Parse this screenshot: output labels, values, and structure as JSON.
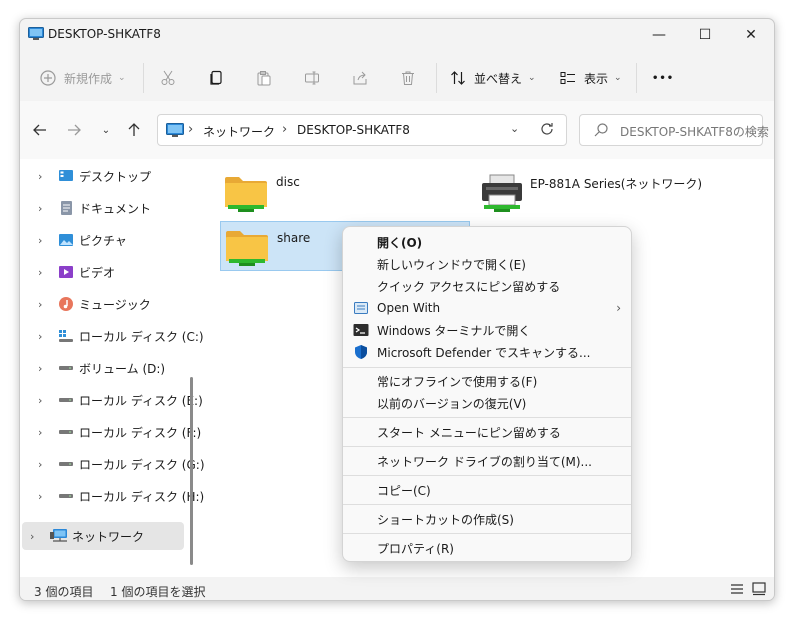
{
  "window": {
    "title": "DESKTOP-SHKATF8",
    "minimize_glyph": "—",
    "maximize_glyph": "☐",
    "close_glyph": "✕"
  },
  "toolbar": {
    "new_label": "新規作成",
    "sort_label": "並べ替え",
    "view_label": "表示",
    "more_glyph": "•••"
  },
  "address": {
    "segments": [
      "ネットワーク",
      "DESKTOP-SHKATF8"
    ],
    "search_placeholder": "DESKTOP-SHKATF8の検索"
  },
  "sidebar": {
    "items": [
      {
        "label": "デスクトップ",
        "icon": "desktop-icon"
      },
      {
        "label": "ドキュメント",
        "icon": "document-icon"
      },
      {
        "label": "ピクチャ",
        "icon": "pictures-icon"
      },
      {
        "label": "ビデオ",
        "icon": "video-icon"
      },
      {
        "label": "ミュージック",
        "icon": "music-icon"
      },
      {
        "label": "ローカル ディスク (C:)",
        "icon": "windows-drive-icon"
      },
      {
        "label": "ボリューム (D:)",
        "icon": "drive-icon"
      },
      {
        "label": "ローカル ディスク (E:)",
        "icon": "drive-icon"
      },
      {
        "label": "ローカル ディスク (F:)",
        "icon": "drive-icon"
      },
      {
        "label": "ローカル ディスク (G:)",
        "icon": "drive-icon"
      },
      {
        "label": "ローカル ディスク (H:)",
        "icon": "drive-icon"
      },
      {
        "label": "ネットワーク",
        "icon": "network-icon",
        "selected": true
      }
    ]
  },
  "files": [
    {
      "label": "disc",
      "icon": "shared-folder-icon"
    },
    {
      "label": "share",
      "icon": "shared-folder-icon",
      "selected": true
    },
    {
      "label": "EP-881A Series(ネットワーク)",
      "icon": "printer-icon"
    }
  ],
  "status": {
    "count": "3 個の項目",
    "selected": "1 個の項目を選択"
  },
  "context_menu": {
    "items": [
      {
        "label": "開く(O)",
        "bold": true
      },
      {
        "label": "新しいウィンドウで開く(E)"
      },
      {
        "label": "クイック アクセスにピン留めする"
      },
      {
        "label": "Open With",
        "icon": "open-with-icon",
        "submenu": true
      },
      {
        "label": "Windows ターミナルで開く",
        "icon": "terminal-icon"
      },
      {
        "label": "Microsoft Defender でスキャンする...",
        "icon": "defender-shield-icon"
      },
      {
        "label": "常にオフラインで使用する(F)"
      },
      {
        "label": "以前のバージョンの復元(V)"
      },
      {
        "label": "スタート メニューにピン留めする"
      },
      {
        "label": "ネットワーク ドライブの割り当て(M)..."
      },
      {
        "label": "コピー(C)"
      },
      {
        "label": "ショートカットの作成(S)"
      },
      {
        "label": "プロパティ(R)"
      }
    ],
    "submenu_glyph": "›"
  },
  "colors": {
    "accent": "#0067c0",
    "selection_bg": "#cce4f7",
    "folder": "#f8c545",
    "share_green": "#2eb82e"
  }
}
